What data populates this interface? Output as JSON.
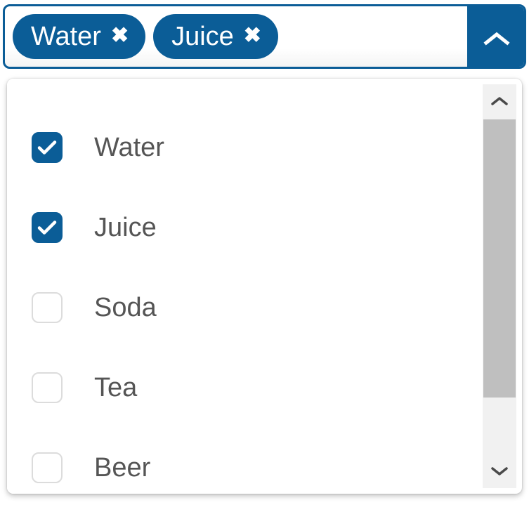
{
  "control": {
    "selected_tags": [
      {
        "label": "Water",
        "remove_icon": "close-x-icon",
        "remove_glyph": "✖"
      },
      {
        "label": "Juice",
        "remove_icon": "close-x-icon",
        "remove_glyph": "✖"
      }
    ],
    "toggle_icon": "chevron-up-icon",
    "expanded": "true",
    "accent_color": "#0b5d97",
    "border_color": "#0b5d97"
  },
  "dropdown": {
    "options": [
      {
        "label": "Water",
        "checked": "true",
        "checkbox_icon": "check-icon"
      },
      {
        "label": "Juice",
        "checked": "true",
        "checkbox_icon": "check-icon"
      },
      {
        "label": "Soda",
        "checked": "false",
        "checkbox_icon": "check-icon"
      },
      {
        "label": "Tea",
        "checked": "false",
        "checkbox_icon": "check-icon"
      },
      {
        "label": "Beer",
        "checked": "false",
        "checkbox_icon": "check-icon"
      }
    ],
    "checked_color": "#0b5d97",
    "unchecked_border_color": "#dcdcdc",
    "label_color": "#555555",
    "scrollbar": {
      "up_icon": "chevron-up-icon",
      "down_icon": "chevron-down-icon",
      "track_color": "#f1f1f1",
      "thumb_color": "#bfbfbf"
    }
  }
}
